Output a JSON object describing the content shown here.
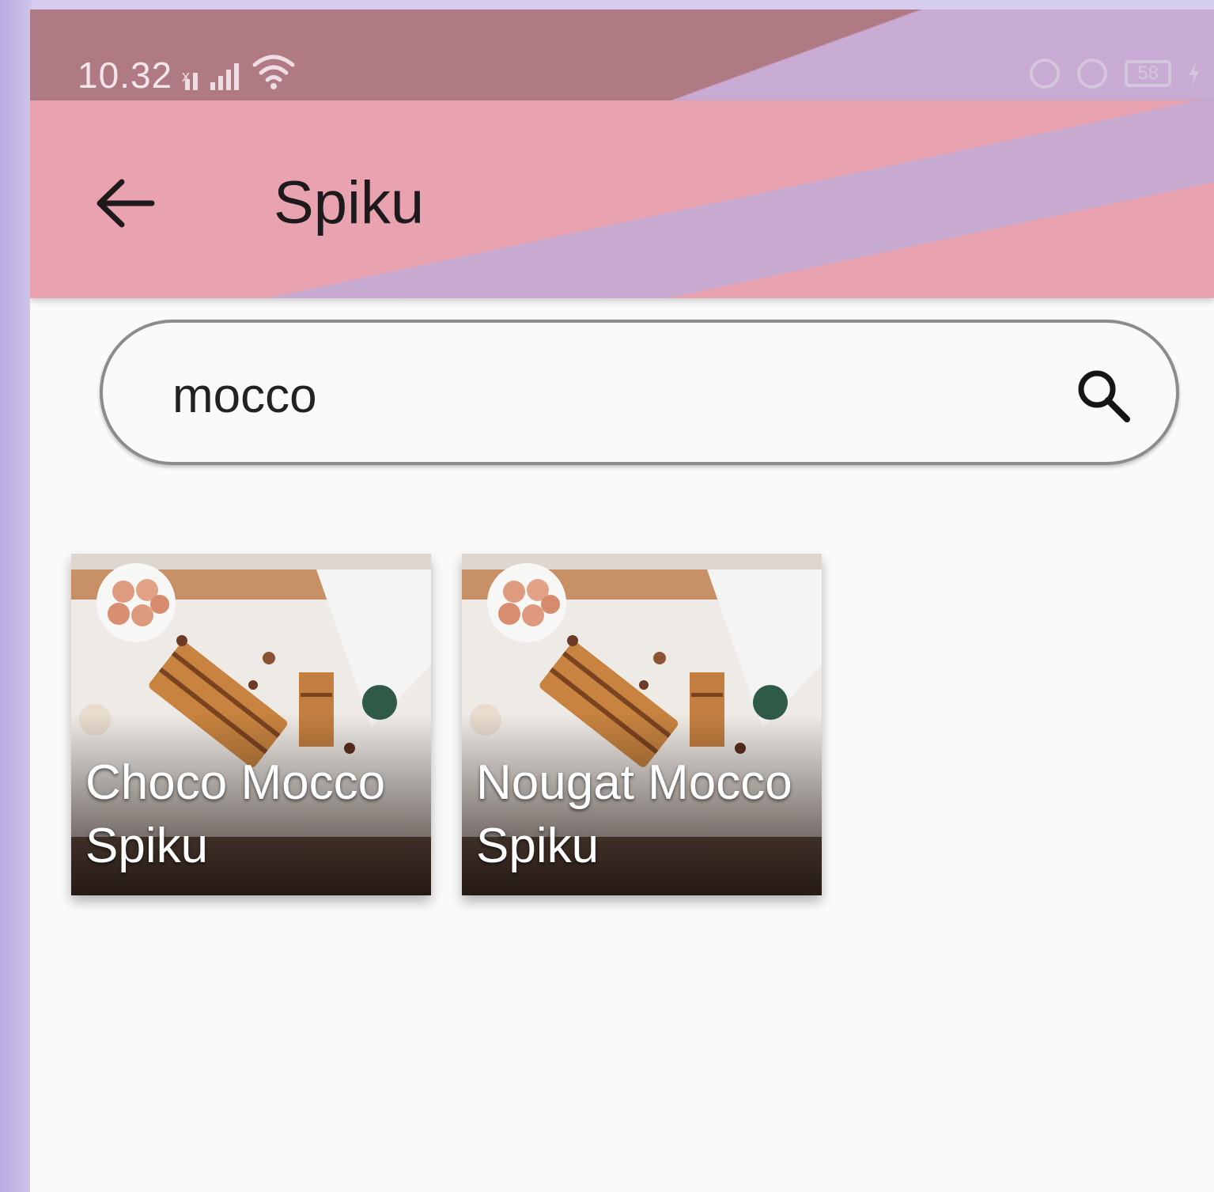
{
  "status_bar": {
    "time": "10.32",
    "network_mark": "x",
    "battery": "58",
    "icons": [
      "signal-icon",
      "signal-icon",
      "wifi-icon",
      "at-icon",
      "alarm-icon",
      "battery-icon",
      "charging-icon"
    ]
  },
  "app_bar": {
    "title": "Spiku",
    "back_icon": "arrow-left-icon"
  },
  "search": {
    "value": "mocco",
    "icon": "search-icon"
  },
  "results": [
    {
      "title": "Choco Mocco Spiku"
    },
    {
      "title": "Nougat Mocco Spiku"
    }
  ],
  "colors": {
    "status_bar": "#b07a84",
    "app_bar": "#e8a2b0",
    "background": "#fafafa",
    "backdrop": "#c8bde6"
  }
}
